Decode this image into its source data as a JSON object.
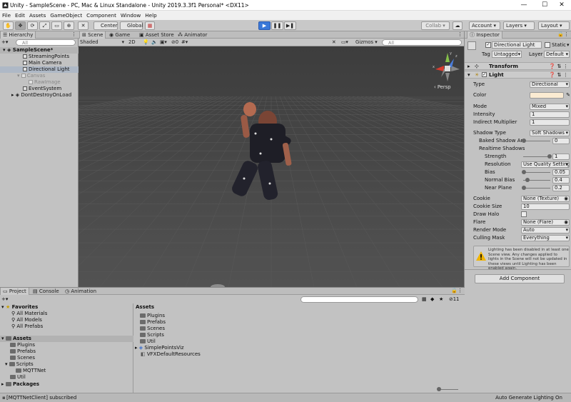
{
  "window": {
    "title": "Unity - SampleScene - PC, Mac & Linux Standalone - Unity 2019.3.3f1 Personal* <DX11>",
    "minimize": "—",
    "maximize": "☐",
    "close": "✕"
  },
  "menu": [
    "File",
    "Edit",
    "Assets",
    "GameObject",
    "Component",
    "Window",
    "Help"
  ],
  "toolbar": {
    "pivot_label": "Center",
    "space_label": "Global",
    "collab_label": "Collab ▾",
    "account_label": "Account",
    "layers_label": "Layers",
    "layout_label": "Layout"
  },
  "hierarchy": {
    "tab": "Hierarchy",
    "search_placeholder": "All",
    "items": [
      {
        "label": "SampleScene*"
      },
      {
        "label": "StreamingPoints"
      },
      {
        "label": "Main Camera"
      },
      {
        "label": "Directional Light"
      },
      {
        "label": "Canvas"
      },
      {
        "label": "RawImage"
      },
      {
        "label": "EventSystem"
      },
      {
        "label": "DontDestroyOnLoad"
      }
    ]
  },
  "scene": {
    "tabs": [
      "Scene",
      "Game",
      "Asset Store",
      "Animator"
    ],
    "shading_mode": "Shaded",
    "mode_2d": "2D",
    "hidden_count": "0",
    "gizmos_label": "Gizmos",
    "search_placeholder": "All",
    "persp_label": "Persp",
    "axis_y": "y",
    "axis_x": "x",
    "axis_z": "z"
  },
  "inspector": {
    "tab": "Inspector",
    "object_name": "Directional Light",
    "static_label": "Static",
    "tag_label": "Tag",
    "tag_value": "Untagged",
    "layer_label": "Layer",
    "layer_value": "Default",
    "transform_label": "Transform",
    "light_label": "Light",
    "rows": [
      {
        "label": "Type",
        "value": "Directional"
      },
      {
        "label": "Color",
        "value": ""
      },
      {
        "label": "Mode",
        "value": "Mixed"
      },
      {
        "label": "Intensity",
        "value": "1"
      },
      {
        "label": "Indirect Multiplier",
        "value": "1"
      },
      {
        "label": "Shadow Type",
        "value": "Soft Shadows"
      },
      {
        "label": "Baked Shadow An",
        "value": "0"
      },
      {
        "label": "Realtime Shadows",
        "value": ""
      },
      {
        "label": "Strength",
        "value": "1"
      },
      {
        "label": "Resolution",
        "value": "Use Quality Setting"
      },
      {
        "label": "Bias",
        "value": "0.05"
      },
      {
        "label": "Normal Bias",
        "value": "0.4"
      },
      {
        "label": "Near Plane",
        "value": "0.2"
      },
      {
        "label": "Cookie",
        "value": "None (Texture)"
      },
      {
        "label": "Cookie Size",
        "value": "10"
      },
      {
        "label": "Draw Halo",
        "value": ""
      },
      {
        "label": "Flare",
        "value": "None (Flare)"
      },
      {
        "label": "Render Mode",
        "value": "Auto"
      },
      {
        "label": "Culling Mask",
        "value": "Everything"
      }
    ],
    "warning": "Lighting has been disabled in at least one Scene view. Any changes applied to lights in the Scene will not be updated in these views until Lighting has been enabled again.",
    "add_component": "Add Component",
    "colors": {
      "light_color": "#fbebd2"
    }
  },
  "project": {
    "tabs": [
      "Project",
      "Console",
      "Animation"
    ],
    "favorites_label": "Favorites",
    "favorites": [
      "All Materials",
      "All Models",
      "All Prefabs"
    ],
    "assets_label": "Assets",
    "tree": [
      "Plugins",
      "Prefabs",
      "Scenes",
      "Scripts",
      "MQTTNet",
      "Util"
    ],
    "packages_label": "Packages",
    "hidden_count": "11",
    "content_header": "Assets",
    "content": [
      "Plugins",
      "Prefabs",
      "Scenes",
      "Scripts",
      "Util",
      "SimplePointsViz",
      "VFXDefaultResources"
    ]
  },
  "status": {
    "message": "[MQTTNetClient] subscribed",
    "right": "Auto Generate Lighting On"
  }
}
